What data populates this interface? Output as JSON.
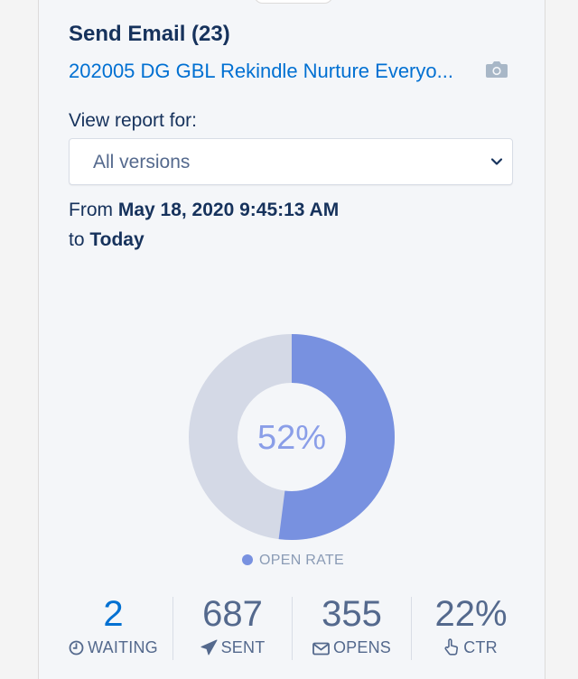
{
  "header": {
    "title": "Send Email (23)",
    "asset_link": "202005 DG GBL Rekindle Nurture Everyo..."
  },
  "report": {
    "view_label": "View report for:",
    "selected_version": "All versions",
    "from_prefix": "From",
    "from_date": "May 18, 2020 9:45:13 AM",
    "to_prefix": "to",
    "to_date": "Today"
  },
  "open_rate": {
    "percent_label": "52%",
    "value_fraction": 0.52,
    "legend": "OPEN RATE",
    "fill_color": "#7891e0",
    "track_color": "#d4d9e6"
  },
  "stats": [
    {
      "value": "2",
      "label": "WAITING",
      "icon": "clock-icon"
    },
    {
      "value": "687",
      "label": "SENT",
      "icon": "paper-plane-icon"
    },
    {
      "value": "355",
      "label": "OPENS",
      "icon": "envelope-icon"
    },
    {
      "value": "22%",
      "label": "CTR",
      "icon": "pointer-hand-icon"
    }
  ]
}
